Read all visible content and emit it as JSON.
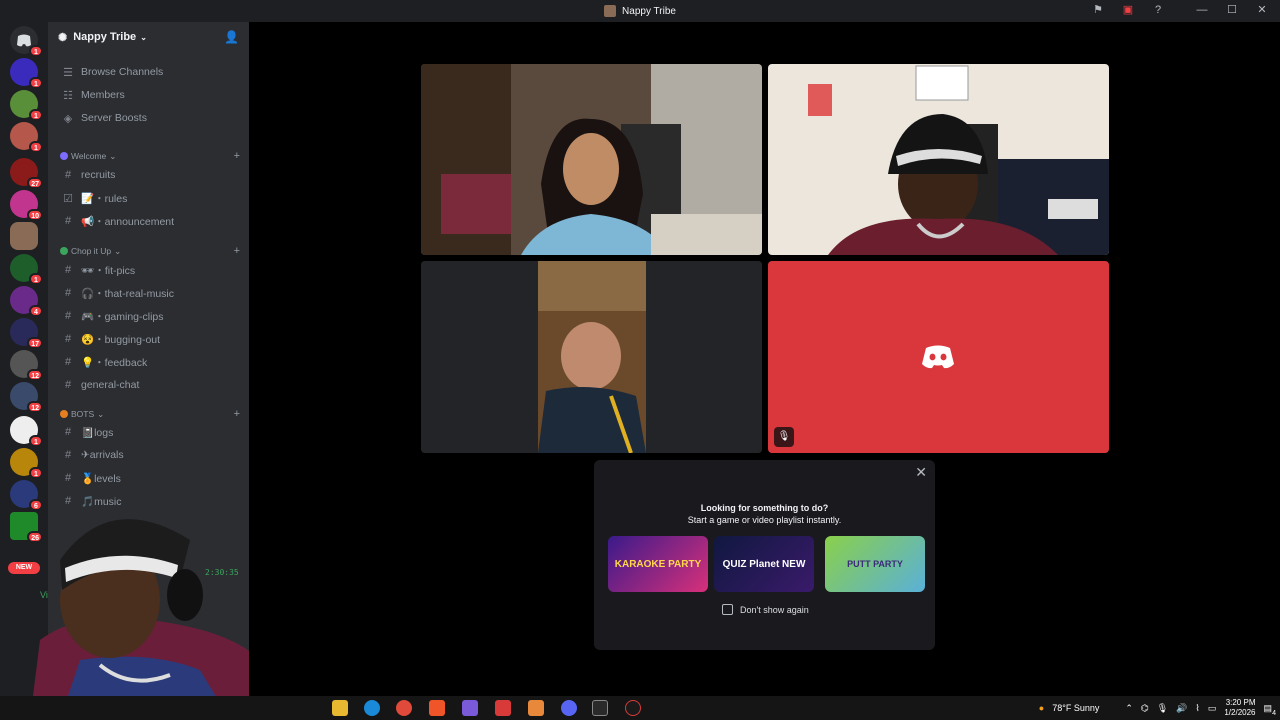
{
  "window": {
    "title": "Nappy Tribe"
  },
  "server": {
    "name": "Nappy Tribe"
  },
  "guild_badges": [
    "1",
    "1",
    "1",
    "1",
    "27",
    "10",
    "",
    "1",
    "4",
    "17",
    "12",
    "12",
    "1",
    "1",
    "6",
    "26"
  ],
  "new_badge": "NEW",
  "top_items": [
    {
      "label": "Browse Channels",
      "icon": "browse-icon"
    },
    {
      "label": "Members",
      "icon": "members-icon"
    },
    {
      "label": "Server Boosts",
      "icon": "boost-icon"
    }
  ],
  "categories": [
    {
      "name": "Welcome",
      "color": "#7c6cff",
      "channels": [
        {
          "label": "recruits"
        },
        {
          "label": "📝・rules"
        },
        {
          "label": "📢・announcement"
        }
      ]
    },
    {
      "name": "Chop it Up",
      "color": "#3ba55d",
      "channels": [
        {
          "label": "🕶・fit-pics"
        },
        {
          "label": "🎧・that-real-music"
        },
        {
          "label": "🎮・gaming-clips"
        },
        {
          "label": "😵・bugging-out"
        },
        {
          "label": "💡・feedback"
        },
        {
          "label": "general-chat"
        }
      ]
    },
    {
      "name": "BOTS",
      "color": "#e67e22",
      "channels": [
        {
          "label": "📓logs"
        },
        {
          "label": "✈arrivals"
        },
        {
          "label": "🏅levels"
        },
        {
          "label": "🎵music"
        }
      ]
    }
  ],
  "voice": {
    "timer": "2:30:35",
    "label": "Vi"
  },
  "popup": {
    "line1": "Looking for something to do?",
    "line2": "Start a game or video playlist instantly.",
    "activities": [
      "KARAOKE PARTY",
      "QUIZ Planet NEW",
      "PUTT PARTY"
    ],
    "checkbox_label": "Don't show again"
  },
  "taskbar": {
    "weather": "78°F  Sunny",
    "time": "3:20 PM",
    "date": "1/2/2026",
    "notification_count": "4"
  },
  "colors": {
    "accent_red": "#da373c",
    "speaking_green": "#3ba55d",
    "sidebar": "#2b2d31",
    "rail": "#1e1f22"
  }
}
